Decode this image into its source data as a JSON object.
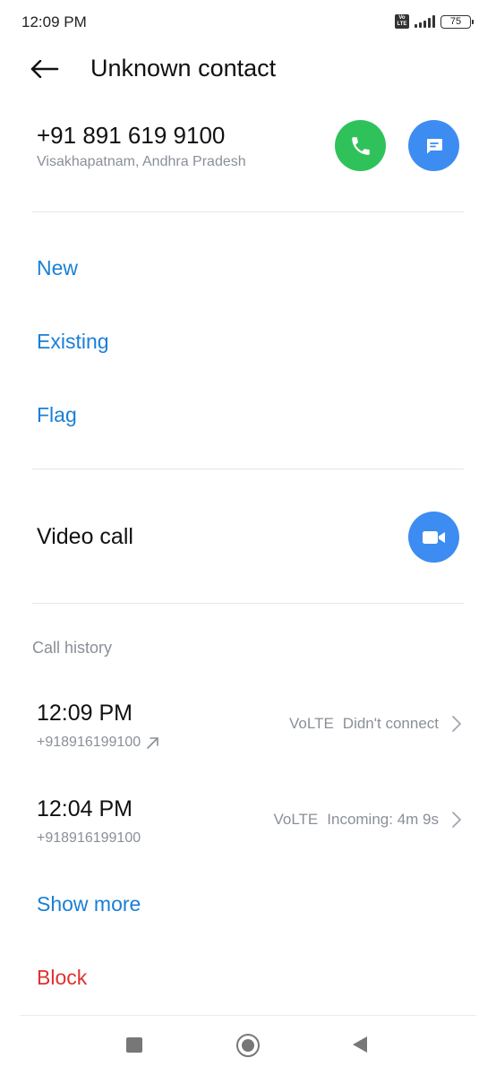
{
  "status_bar": {
    "time": "12:09 PM",
    "volte_badge": "Vo LTE",
    "battery": "75"
  },
  "header": {
    "title": "Unknown contact",
    "back_icon": "arrow-left-icon"
  },
  "contact": {
    "number": "+91 891 619 9100",
    "location": "Visakhapatnam, Andhra Pradesh",
    "call_icon": "phone-icon",
    "message_icon": "message-icon",
    "call_color": "#2fc25b",
    "message_color": "#3d8cf2"
  },
  "actions": {
    "new_label": "New",
    "existing_label": "Existing",
    "flag_label": "Flag"
  },
  "video": {
    "label": "Video call",
    "icon": "video-camera-icon"
  },
  "call_history": {
    "section_label": "Call history",
    "entries": [
      {
        "time": "12:09 PM",
        "number": "+918916199100",
        "network": "VoLTE",
        "status": "Didn't connect",
        "direction_icon": "outgoing-arrow-icon"
      },
      {
        "time": "12:04 PM",
        "number": "+918916199100",
        "network": "VoLTE",
        "status": "Incoming: 4m 9s"
      }
    ],
    "show_more_label": "Show more"
  },
  "block_label": "Block",
  "colors": {
    "accent_link": "#1a7fd6",
    "danger": "#e03131",
    "secondary_text": "#8a8f98"
  }
}
